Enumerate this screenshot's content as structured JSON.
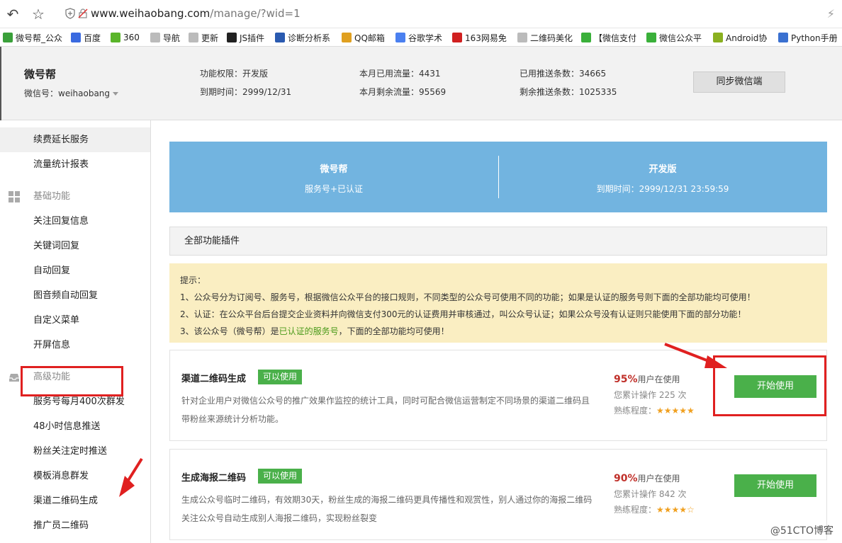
{
  "browser": {
    "url_host": "www.weihaobang.com",
    "url_path": "/manage/?wid=1",
    "bookmarks": [
      {
        "label": "微号帮_公众",
        "color": "#3aa03a"
      },
      {
        "label": "百度",
        "color": "#3a6ae0"
      },
      {
        "label": "360",
        "color": "#5ab52a"
      },
      {
        "label": "导航",
        "color": "#bbbbbb"
      },
      {
        "label": "更新",
        "color": "#bbbbbb"
      },
      {
        "label": "JS插件",
        "color": "#222222"
      },
      {
        "label": "诊断分析系",
        "color": "#2a5ab0"
      },
      {
        "label": "QQ邮箱",
        "color": "#e0a020"
      },
      {
        "label": "谷歌学术",
        "color": "#4a80f0"
      },
      {
        "label": "163网易免",
        "color": "#d02020"
      },
      {
        "label": "二维码美化",
        "color": "#bbbbbb"
      },
      {
        "label": "【微信支付",
        "color": "#3ab03a"
      },
      {
        "label": "微信公众平",
        "color": "#3ab03a"
      },
      {
        "label": "Android协",
        "color": "#8ab020"
      },
      {
        "label": "Python手册",
        "color": "#3a70d0"
      }
    ]
  },
  "account": {
    "name": "微号帮",
    "wxid": "微信号：weihaobang",
    "perm": "功能权限：开发版",
    "expire": "到期时间：2999/12/31",
    "used_flow": "本月已用流量：4431",
    "left_flow": "本月剩余流量：95569",
    "used_push": "已用推送条数：34665",
    "left_push": "剩余推送条数：1025335",
    "sync_label": "同步微信端"
  },
  "sidebar": {
    "items_top": [
      "续费延长服务",
      "流量统计报表"
    ],
    "group_basic": "基础功能",
    "items_basic": [
      "关注回复信息",
      "关键词回复",
      "自动回复",
      "图音频自动回复",
      "自定义菜单",
      "开屏信息"
    ],
    "group_adv": "高级功能",
    "items_adv": [
      "服务号每月400次群发",
      "48小时信息推送",
      "粉丝关注定时推送",
      "模板消息群发",
      "渠道二维码生成",
      "推广员二维码"
    ]
  },
  "banner": {
    "left_title": "微号帮",
    "left_sub": "服务号+已认证",
    "right_title": "开发版",
    "right_sub": "到期时间：2999/12/31 23:59:59"
  },
  "section_title": "全部功能插件",
  "notice": {
    "head": "提示：",
    "line1": "1、公众号分为订阅号、服务号，根据微信公众平台的接口规则，不同类型的公众号可使用不同的功能；如果是认证的服务号则下面的全部功能均可使用！",
    "line2": "2、认证：在公众平台后台提交企业资料并向微信支付300元的认证费用并审核通过，叫公众号认证；如果公众号没有认证则只能使用下面的部分功能！",
    "line3_pre": "3、该公众号（微号帮）是",
    "line3_hl": "已认证的服务号",
    "line3_post": "，下面的全部功能均可使用！"
  },
  "cards": [
    {
      "title": "渠道二维码生成",
      "badge": "可以使用",
      "desc1": "针对企业用户对微信公众号的推广效果作监控的统计工具，同时可配合微信运营制定不同场景的渠道二维码且",
      "desc2": "带粉丝来源统计分析功能。",
      "pct": "95%",
      "pct_suffix": "用户在使用",
      "uses": "您累计操作 225 次",
      "skill": "熟练程度：",
      "stars": "★★★★★",
      "btn": "开始使用"
    },
    {
      "title": "生成海报二维码",
      "badge": "可以使用",
      "desc1": "生成公众号临时二维码，有效期30天，粉丝生成的海报二维码更具传播性和观赏性，别人通过你的海报二维码",
      "desc2": "关注公众号自动生成别人海报二维码，实现粉丝裂变",
      "pct": "90%",
      "pct_suffix": "用户在使用",
      "uses": "您累计操作 842 次",
      "skill": "熟练程度：",
      "stars": "★★★★☆",
      "btn": "开始使用"
    }
  ],
  "watermark": "@51CTO博客"
}
